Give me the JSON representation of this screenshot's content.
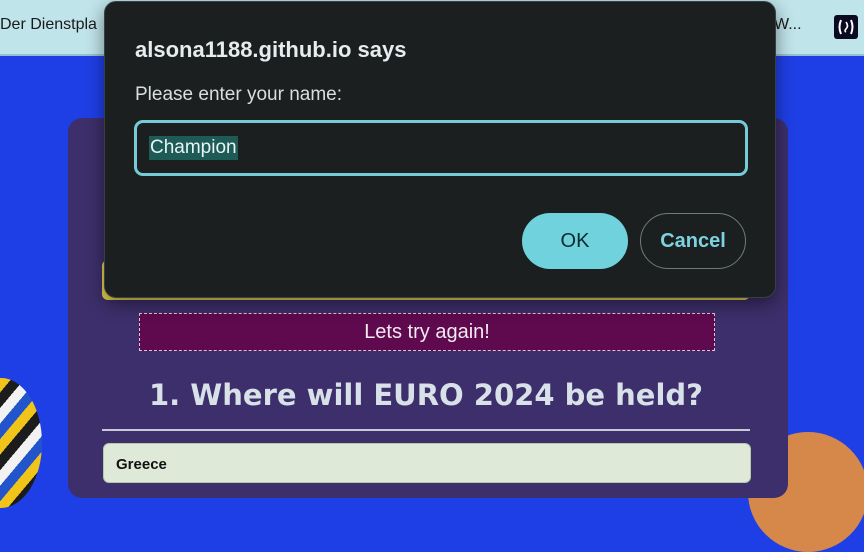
{
  "bookmarks": {
    "left_item": "Der Dienstpla",
    "right_item": "W...",
    "icon": "code-bracket-icon"
  },
  "dialog": {
    "title": "alsona1188.github.io says",
    "message": "Please enter your name:",
    "input_value": "Champion",
    "ok_label": "OK",
    "cancel_label": "Cancel"
  },
  "page": {
    "banner": "Lets try again!",
    "question": "1. Where will EURO 2024 be held?",
    "answers": [
      "Greece"
    ]
  },
  "colors": {
    "page_background": "#1f3fe6",
    "card": "#3d2f6b",
    "banner": "#5f0a4e",
    "accent": "#6fd2dd",
    "dialog_background": "#1c1f20"
  }
}
